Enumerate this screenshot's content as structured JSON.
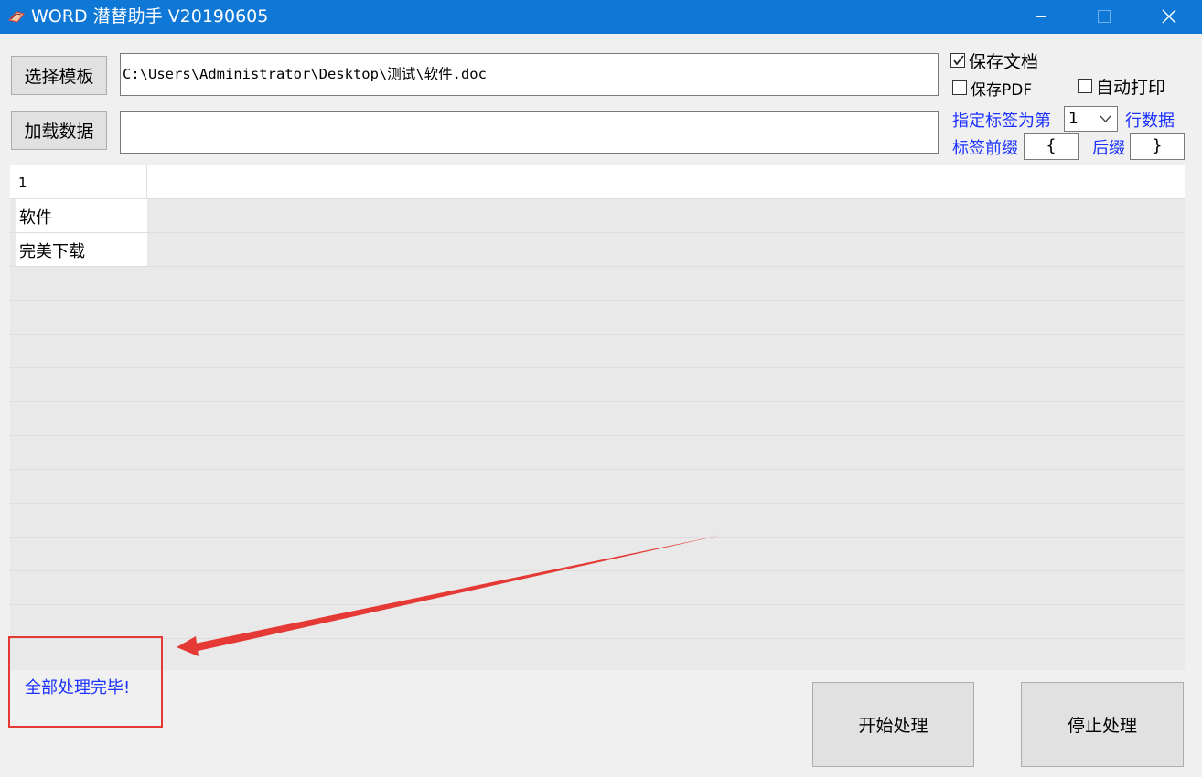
{
  "window": {
    "title": "WORD 潜替助手 V20190605",
    "icon": "app-icon",
    "controls": [
      "minimize-icon",
      "maximize-icon",
      "close-icon"
    ]
  },
  "toolbar": {
    "select_template_label": "选择模板",
    "template_path": "C:\\Users\\Administrator\\Desktop\\测试\\软件.doc",
    "load_data_label": "加载数据",
    "data_path": ""
  },
  "options": {
    "save_doc_label": "保存文档",
    "save_doc_checked": true,
    "save_pdf_label": "保存PDF",
    "save_pdf_checked": false,
    "auto_print_label": "自动打印",
    "auto_print_checked": false,
    "label_row_prefix": "指定标签为第",
    "label_row_value": "1",
    "label_row_suffix": "行数据",
    "tag_prefix_label": "标签前缀",
    "tag_prefix_value": "{",
    "tag_suffix_label": "后缀",
    "tag_suffix_value": "}"
  },
  "grid": {
    "header": "1",
    "rows": [
      "软件",
      "完美下载"
    ]
  },
  "status": {
    "message": "全部处理完毕!"
  },
  "actions": {
    "start_label": "开始处理",
    "stop_label": "停止处理"
  },
  "colors": {
    "titlebar": "#0f78d7",
    "label_blue": "#1c32ff",
    "annotation_red": "#e53935"
  }
}
